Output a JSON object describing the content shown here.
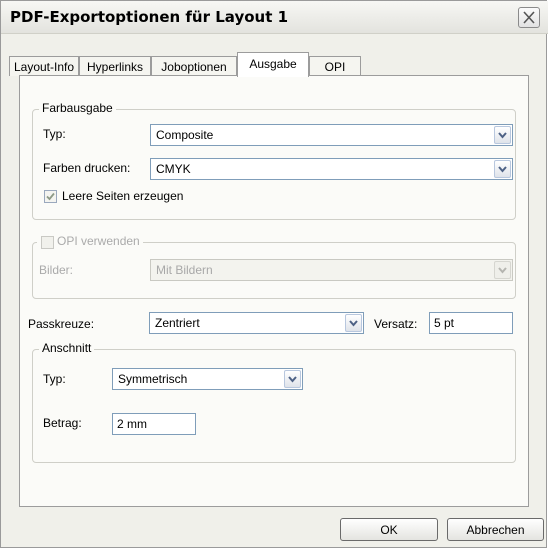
{
  "window": {
    "title": "PDF-Exportoptionen für Layout 1"
  },
  "tabs": [
    {
      "label": "Layout-Info"
    },
    {
      "label": "Hyperlinks"
    },
    {
      "label": "Joboptionen"
    },
    {
      "label": "Ausgabe",
      "active": true
    },
    {
      "label": "OPI"
    }
  ],
  "farbausgabe": {
    "legend": "Farbausgabe",
    "typ_label": "Typ:",
    "typ_value": "Composite",
    "farben_label": "Farben drucken:",
    "farben_value": "CMYK",
    "leere_seiten_label": "Leere Seiten erzeugen",
    "leere_seiten_checked": true
  },
  "opi": {
    "checkbox_label": "OPI verwenden",
    "bilder_label": "Bilder:",
    "bilder_value": "Mit Bildern",
    "enabled": false
  },
  "passkreuze": {
    "label": "Passkreuze:",
    "value": "Zentriert",
    "versatz_label": "Versatz:",
    "versatz_value": "5 pt"
  },
  "anschnitt": {
    "legend": "Anschnitt",
    "typ_label": "Typ:",
    "typ_value": "Symmetrisch",
    "betrag_label": "Betrag:",
    "betrag_value": "2 mm"
  },
  "buttons": {
    "ok": "OK",
    "cancel": "Abbrechen"
  },
  "icons": {
    "close": "close-icon",
    "dropdown": "chevron-down-icon",
    "check": "check-icon"
  }
}
